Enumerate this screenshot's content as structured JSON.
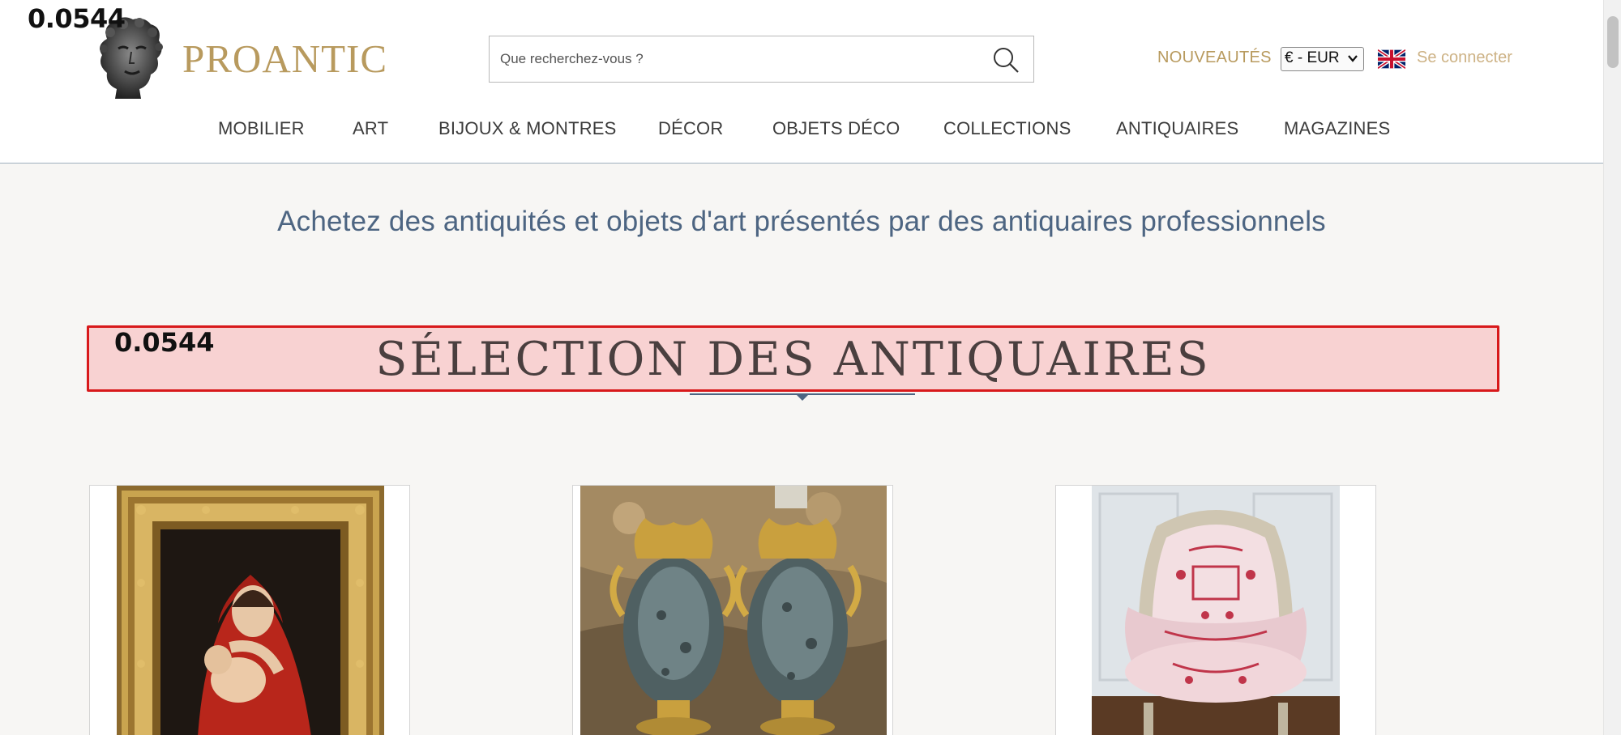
{
  "overlay": {
    "score_top": "0.0544",
    "score_section": "0.0544"
  },
  "header": {
    "logo_text": "PROANTIC",
    "search": {
      "placeholder": "Que recherchez-vous ?"
    },
    "nouveautes": "NOUVEAUTÉS",
    "currency": "€ - EUR",
    "connect": "Se connecter"
  },
  "nav": {
    "items": [
      {
        "label": "MOBILIER"
      },
      {
        "label": "ART"
      },
      {
        "label": "BIJOUX & MONTRES"
      },
      {
        "label": "DÉCOR"
      },
      {
        "label": "OBJETS DÉCO"
      },
      {
        "label": "COLLECTIONS"
      },
      {
        "label": "ANTIQUAIRES"
      },
      {
        "label": "MAGAZINES"
      }
    ]
  },
  "main": {
    "tagline": "Achetez des antiquités et objets d'art présentés par des antiquaires professionnels",
    "section_title": "SÉLECTION DES ANTIQUAIRES"
  },
  "colors": {
    "brand_gold": "#b89a5e",
    "tagline_blue": "#4d6582",
    "highlight_fill": "#f8d2d2",
    "highlight_border": "#d8191b"
  },
  "icons": [
    "search-icon",
    "chevron-down-icon",
    "uk-flag-icon"
  ]
}
